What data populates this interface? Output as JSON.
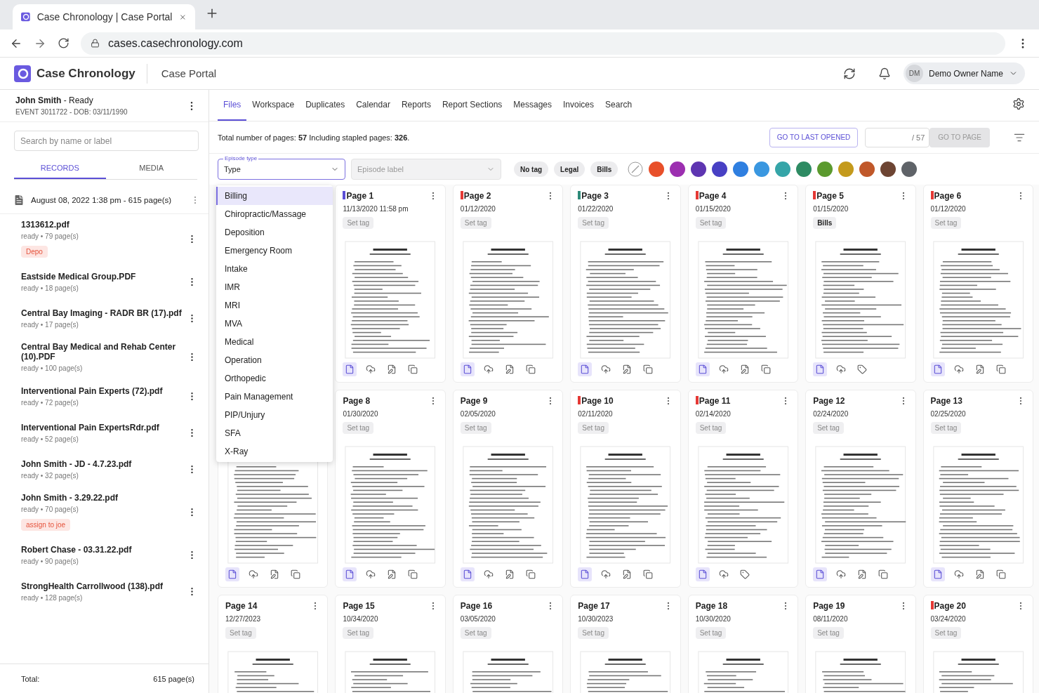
{
  "browser": {
    "tab_title": "Case Chronology | Case Portal",
    "url": "cases.casechronology.com"
  },
  "app": {
    "brand": "Case Chronology",
    "section": "Case Portal",
    "user": {
      "initials": "DM",
      "name": "Demo Owner Name"
    }
  },
  "sidebar": {
    "case_title": "**John Smith** - Ready",
    "case_meta": "EVENT 3011722 - DOB: 03/11/1990",
    "search": {
      "placeholder": "Search by name or label"
    },
    "tabs": [
      {
        "label": "RECORDS",
        "selected": true
      },
      {
        "label": "MEDIA",
        "selected": false
      }
    ],
    "group": "August 08, 2022 1:38 pm - 615 page(s)",
    "files": [
      {
        "name": "1313612.pdf",
        "meta": "ready • 79 page(s)",
        "tag": "Depo"
      },
      {
        "name": "Eastside Medical Group.PDF",
        "meta": "ready • 18 page(s)"
      },
      {
        "name": "Central Bay Imaging - RADR BR (17).pdf",
        "meta": "ready • 17 page(s)"
      },
      {
        "name": "Central Bay Medical and Rehab Center (10).PDF",
        "meta": "ready • 100 page(s)"
      },
      {
        "name": "Interventional Pain Experts (72).pdf",
        "meta": "ready • 72 page(s)"
      },
      {
        "name": "Interventional Pain ExpertsRdr.pdf",
        "meta": "ready • 52 page(s)"
      },
      {
        "name": "John Smith - JD - 4.7.23.pdf",
        "meta": "ready • 32 page(s)"
      },
      {
        "name": "John Smith - 3.29.22.pdf",
        "meta": "ready • 70 page(s)",
        "tag": "assign to joe"
      },
      {
        "name": "Robert Chase - 03.31.22.pdf",
        "meta": "ready • 90 page(s)"
      },
      {
        "name": "StrongHealth Carrollwood (138).pdf",
        "meta": "ready • 128 page(s)"
      }
    ],
    "total_label": "Total:",
    "total_value": "615 page(s)"
  },
  "nav_tabs": [
    {
      "label": "Files",
      "selected": true
    },
    {
      "label": "Workspace",
      "selected": false
    },
    {
      "label": "Duplicates",
      "selected": false
    },
    {
      "label": "Calendar",
      "selected": false
    },
    {
      "label": "Reports",
      "selected": false
    },
    {
      "label": "Report Sections",
      "selected": false
    },
    {
      "label": "Messages",
      "selected": false
    },
    {
      "label": "Invoices",
      "selected": false
    },
    {
      "label": "Search",
      "selected": false
    }
  ],
  "summary": "Total number of pages: **57**  Including stapled pages: **326**.",
  "go_last": "GO TO LAST OPENED",
  "page_total": "/ 57",
  "go_page": "GO TO PAGE",
  "episode_type": {
    "label": "Episode type",
    "value": "Type"
  },
  "episode_label": {
    "placeholder": "Episode label"
  },
  "tag_filters": [
    "No tag",
    "Legal",
    "Bills"
  ],
  "color_filters": [
    {
      "color": "#e8502a"
    },
    {
      "color": "#9c2fb0"
    },
    {
      "color": "#5e35b1"
    },
    {
      "color": "#4840c4"
    },
    {
      "color": "#2f7fe0"
    },
    {
      "color": "#3a97e0"
    },
    {
      "color": "#35a5a8"
    },
    {
      "color": "#2e8b63"
    },
    {
      "color": "#5b9a2e"
    },
    {
      "color": "#c49a1c"
    },
    {
      "color": "#c0582a"
    },
    {
      "color": "#6d4533"
    },
    {
      "color": "#5f6368"
    }
  ],
  "dropdown": [
    {
      "label": "Billing",
      "selected": true
    },
    {
      "label": "Chiropractic/Massage",
      "selected": false
    },
    {
      "label": "Deposition",
      "selected": false
    },
    {
      "label": "Emergency Room",
      "selected": false
    },
    {
      "label": "Intake",
      "selected": false
    },
    {
      "label": "IMR",
      "selected": false
    },
    {
      "label": "MRI",
      "selected": false
    },
    {
      "label": "MVA",
      "selected": false
    },
    {
      "label": "Medical",
      "selected": false
    },
    {
      "label": "Operation",
      "selected": false
    },
    {
      "label": "Orthopedic",
      "selected": false
    },
    {
      "label": "Pain Management",
      "selected": false
    },
    {
      "label": "PIP/Unjury",
      "selected": false
    },
    {
      "label": "SFA",
      "selected": false
    },
    {
      "label": "X-Ray",
      "selected": false
    }
  ],
  "cards": [
    {
      "title": "Page 1",
      "date": "11/13/2020 11:58 pm",
      "tag": {
        "label": "Set tag",
        "set": false
      },
      "color": "#5b4fd6",
      "kind": "standard"
    },
    {
      "title": "Page 2",
      "date": "01/12/2020",
      "tag": {
        "label": "Set tag",
        "set": false
      },
      "color": "#e53935",
      "kind": "standard"
    },
    {
      "title": "Page 3",
      "date": "01/22/2020",
      "tag": {
        "label": "Set tag",
        "set": false
      },
      "color": "#2e8b7a",
      "kind": "standard"
    },
    {
      "title": "Page 4",
      "date": "01/15/2020",
      "tag": {
        "label": "Set tag",
        "set": false
      },
      "color": "#e53935",
      "kind": "standard"
    },
    {
      "title": "Page 5",
      "date": "01/15/2020",
      "tag": {
        "label": "Bills",
        "set": true
      },
      "color": "#e53935",
      "kind": "tagged"
    },
    {
      "title": "Page 6",
      "date": "01/12/2020",
      "tag": {
        "label": "Set tag",
        "set": false
      },
      "color": "#e53935",
      "kind": "standard"
    },
    {
      "kind": "standard"
    },
    {
      "title": "Page 8",
      "date": "01/30/2020",
      "tag": {
        "label": "Set tag",
        "set": false
      },
      "kind": "standard"
    },
    {
      "title": "Page 9",
      "date": "02/05/2020",
      "tag": {
        "label": "Set tag",
        "set": false
      },
      "kind": "standard"
    },
    {
      "title": "Page 10",
      "date": "02/11/2020",
      "tag": {
        "label": "Set tag",
        "set": false
      },
      "color": "#e53935",
      "kind": "standard"
    },
    {
      "title": "Page 11",
      "date": "02/14/2020",
      "tag": {
        "label": "Set tag",
        "set": false
      },
      "color": "#e53935",
      "kind": "tagged"
    },
    {
      "title": "Page 12",
      "date": "02/24/2020",
      "tag": {
        "label": "Set tag",
        "set": false
      },
      "kind": "standard"
    },
    {
      "title": "Page 13",
      "date": "02/25/2020",
      "tag": {
        "label": "Set tag",
        "set": false
      },
      "kind": "standard"
    },
    {
      "title": "Page 14",
      "date": "12/27/2023",
      "tag": {
        "label": "Set tag",
        "set": false
      }
    },
    {
      "title": "Page 15",
      "date": "10/34/2020",
      "tag": {
        "label": "Set tag",
        "set": false
      }
    },
    {
      "title": "Page 16",
      "date": "03/05/2020",
      "tag": {
        "label": "Set tag",
        "set": false
      }
    },
    {
      "title": "Page 17",
      "date": "10/30/2023",
      "tag": {
        "label": "Set tag",
        "set": false
      }
    },
    {
      "title": "Page 18",
      "date": "10/30/2020",
      "tag": {
        "label": "Set tag",
        "set": false
      }
    },
    {
      "title": "Page 19",
      "date": "08/11/2020",
      "tag": {
        "label": "Set tag",
        "set": false
      }
    },
    {
      "title": "Page 20",
      "date": "03/24/2020",
      "tag": {
        "label": "Set tag",
        "set": false
      },
      "color": "#e53935"
    }
  ]
}
